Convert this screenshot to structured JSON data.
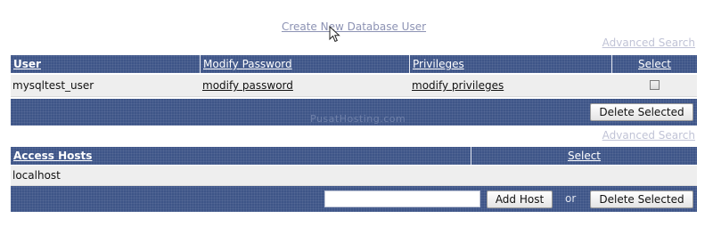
{
  "top": {
    "create_user_link": "Create New Database User"
  },
  "users_section": {
    "advanced_search": "Advanced Search",
    "headers": {
      "user": "User",
      "modify_password": "Modify Password",
      "privileges": "Privileges",
      "select": "Select"
    },
    "rows": [
      {
        "user": "mysqltest_user",
        "modify_password": "modify password",
        "privileges": "modify privileges",
        "selected": false
      }
    ],
    "delete_button": "Delete Selected",
    "watermark": "PusatHosting.com"
  },
  "hosts_section": {
    "advanced_search": "Advanced Search",
    "headers": {
      "access_hosts": "Access Hosts",
      "select": "Select"
    },
    "rows": [
      {
        "host": "localhost"
      }
    ],
    "host_input": {
      "value": "",
      "placeholder": ""
    },
    "add_host_button": "Add Host",
    "or_label": "or",
    "delete_button": "Delete Selected"
  },
  "colors": {
    "header_bg": "#3e5588",
    "row_bg": "#eeeeee",
    "link_muted": "#8d93b4"
  },
  "icons": {
    "cursor": "mouse-pointer-icon"
  }
}
